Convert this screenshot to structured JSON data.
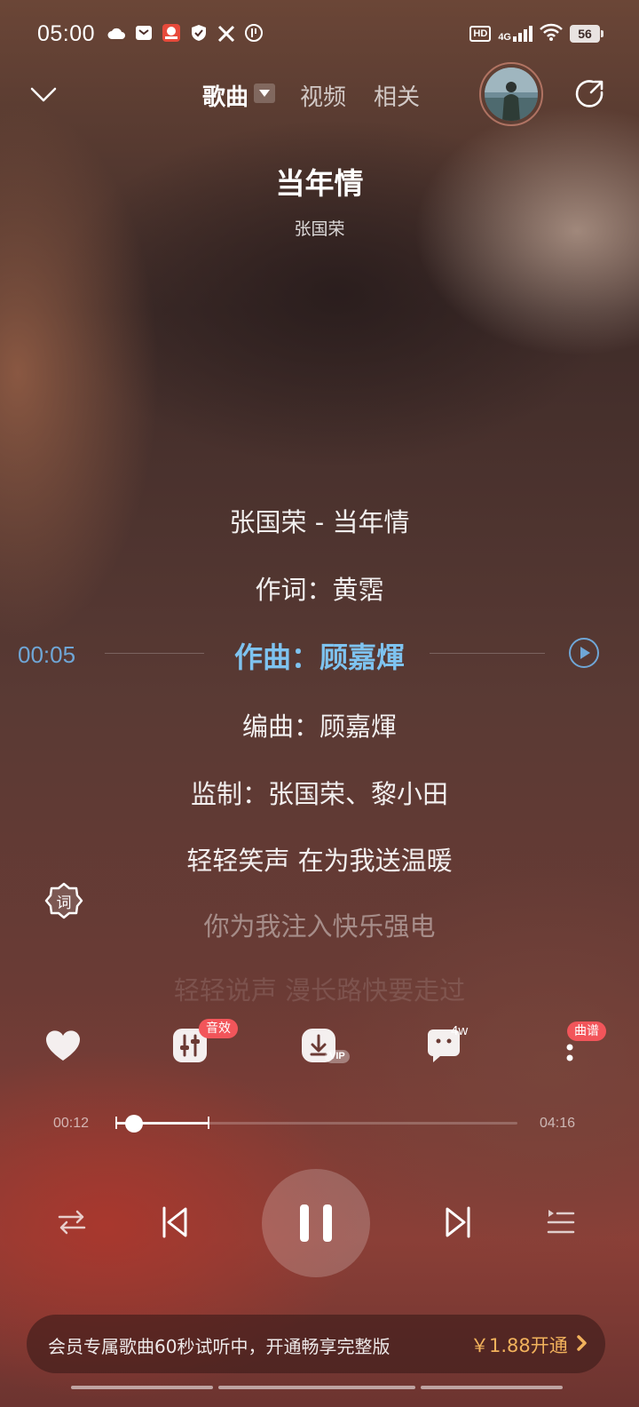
{
  "status_bar": {
    "time": "05:00",
    "hd_label": "HD",
    "network_label": "4G",
    "battery": "56"
  },
  "nav": {
    "tabs": [
      {
        "label": "歌曲",
        "active": true
      },
      {
        "label": "视频",
        "active": false
      },
      {
        "label": "相关",
        "active": false
      }
    ]
  },
  "song": {
    "title": "当年情",
    "artist": "张国荣"
  },
  "lyrics": {
    "current_time": "00:05",
    "lines": [
      "张国荣 - 当年情",
      "作词：黄霑",
      "作曲：顾嘉煇",
      "编曲：顾嘉煇",
      "监制：张国荣、黎小田",
      "轻轻笑声 在为我送温暖",
      "你为我注入快乐强电",
      "轻轻说声 漫长路快要走过"
    ],
    "current_index": 2,
    "lyric_button_label": "词"
  },
  "actions": {
    "sound_effect_badge": "音效",
    "comment_count": "4w",
    "vip_label": "VIP",
    "sheet_badge": "曲谱"
  },
  "progress": {
    "elapsed": "00:12",
    "total": "04:16",
    "played_fraction": 0.047,
    "buffered_fraction": 0.231
  },
  "vip_banner": {
    "text": "会员专属歌曲60秒试听中，开通畅享完整版",
    "price_cta": "￥1.88开通"
  },
  "colors": {
    "current_lyric": "#7ec3f0",
    "time_accent": "#6fa6d6",
    "badge_red": "#f2555a",
    "vip_gold": "#f2b25c"
  }
}
